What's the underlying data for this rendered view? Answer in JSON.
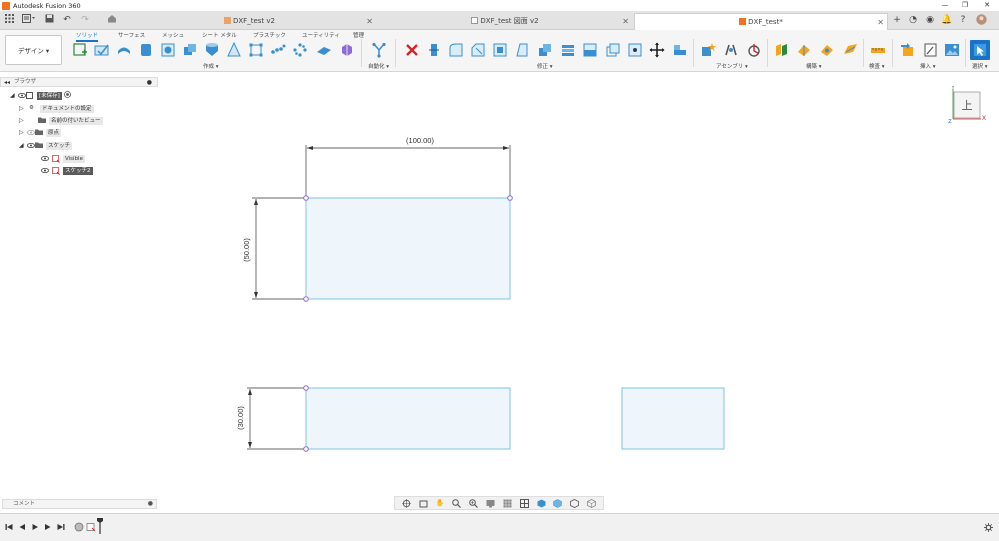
{
  "app": {
    "title": "Autodesk Fusion 360"
  },
  "tabs": [
    {
      "label": "DXF_test v2",
      "active": false
    },
    {
      "label": "DXF_test 図面 v2",
      "active": false
    },
    {
      "label": "DXF_test*",
      "active": true
    }
  ],
  "toolbar": {
    "workspace": "デザイン ▾",
    "tabs": [
      {
        "label": "ソリッド",
        "active": true
      },
      {
        "label": "サーフェス",
        "active": false
      },
      {
        "label": "メッシュ",
        "active": false
      },
      {
        "label": "シート メタル",
        "active": false
      },
      {
        "label": "プラスチック",
        "active": false
      },
      {
        "label": "ユーティリティ",
        "active": false
      },
      {
        "label": "管理",
        "active": false
      }
    ],
    "groups": [
      "作成 ▾",
      "自動化 ▾",
      "修正 ▾",
      "アセンブリ ▾",
      "構築 ▾",
      "検査 ▾",
      "挿入 ▾",
      "選択 ▾"
    ]
  },
  "browser": {
    "title": "ブラウザ",
    "items": [
      {
        "label": "[未保存]"
      },
      {
        "label": "ドキュメントの設定"
      },
      {
        "label": "名前の付いたビュー"
      },
      {
        "label": "原点"
      },
      {
        "label": "スケッチ"
      },
      {
        "label": "Visible"
      },
      {
        "label": "スケッチ2"
      }
    ]
  },
  "sketch": {
    "dim_width": "(100.00)",
    "dim_height": "(50.00)",
    "dim_height2": "(30.00)"
  },
  "viewcube": {
    "face": "上",
    "axis_x": "X",
    "axis_y": "Y",
    "axis_z": "Z"
  },
  "comment": {
    "label": "コメント"
  },
  "colors": {
    "accent": "#1a73c8",
    "sketch_line": "#7ec4e4",
    "sketch_fill": "#eef6fc",
    "sketch_point": "#8a6ad8",
    "dim_line": "#333333"
  }
}
